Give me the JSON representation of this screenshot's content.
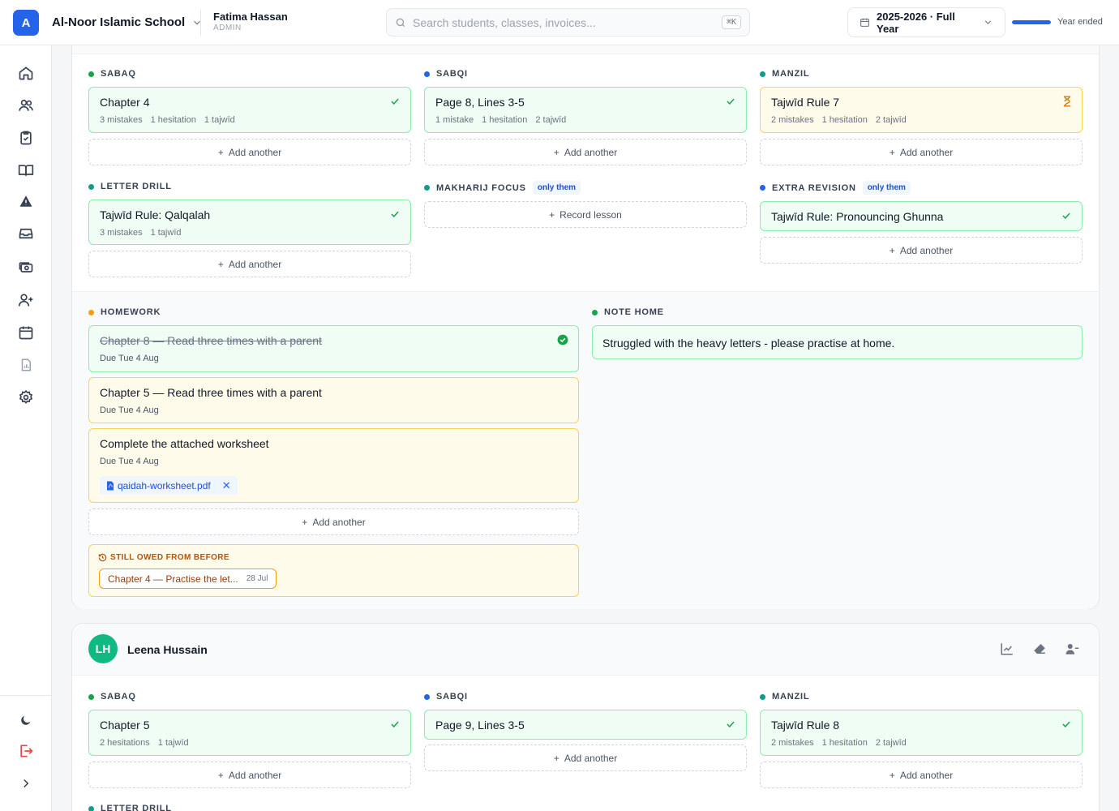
{
  "header": {
    "logo_letter": "A",
    "school_name": "Al-Noor Islamic School",
    "user_name": "Fatima Hassan",
    "user_role": "ADMIN",
    "search_placeholder": "Search students, classes, invoices...",
    "search_shortcut": "⌘K",
    "year_label": "2025-2026 · Full Year",
    "year_progress_percent": 100,
    "year_status": "Year ended"
  },
  "sidebar": {
    "items": [
      "home-icon",
      "users-icon",
      "clipboard-check-icon",
      "book-icon",
      "alert-icon",
      "inbox-icon",
      "money-icon",
      "user-plus-icon",
      "calendar-icon",
      "report-icon",
      "gear-icon"
    ],
    "footer": [
      "moon-icon",
      "logout-icon",
      "chevron-right-icon"
    ]
  },
  "student1": {
    "sabaq": {
      "label": "SABAQ",
      "title": "Chapter 4",
      "meta": [
        "3 mistakes",
        "1 hesitation",
        "1 tajwīd"
      ],
      "add": "Add another"
    },
    "sabqi": {
      "label": "SABQI",
      "title": "Page 8, Lines 3-5",
      "meta": [
        "1 mistake",
        "1 hesitation",
        "2 tajwīd"
      ],
      "add": "Add another"
    },
    "manzil": {
      "label": "MANZIL",
      "title": "Tajwīd Rule 7",
      "meta": [
        "2 mistakes",
        "1 hesitation",
        "2 tajwīd"
      ],
      "add": "Add another"
    },
    "letter_drill": {
      "label": "LETTER DRILL",
      "title": "Tajwīd Rule: Qalqalah",
      "meta": [
        "3 mistakes",
        "1 tajwīd"
      ],
      "add": "Add another"
    },
    "makharij": {
      "label": "MAKHARIJ FOCUS",
      "tag": "only them",
      "record": "Record lesson"
    },
    "extra": {
      "label": "EXTRA REVISION",
      "tag": "only them",
      "title": "Tajwīd Rule: Pronouncing Ghunna",
      "add": "Add another"
    },
    "homework": {
      "label": "HOMEWORK",
      "items": [
        {
          "title": "Chapter 8 — Read three times with a parent",
          "due": "Due Tue 4 Aug"
        },
        {
          "title": "Chapter 5 — Read three times with a parent",
          "due": "Due Tue 4 Aug"
        },
        {
          "title": "Complete the attached worksheet",
          "due": "Due Tue 4 Aug",
          "file": "qaidah-worksheet.pdf"
        }
      ],
      "add": "Add another",
      "owed_label": "STILL OWED FROM BEFORE",
      "owed_item": "Chapter 4 — Practise the let...",
      "owed_date": "28 Jul"
    },
    "note": {
      "label": "NOTE HOME",
      "text": "Struggled with the heavy letters - please practise at home."
    }
  },
  "student2": {
    "initials": "LH",
    "name": "Leena Hussain",
    "sabaq": {
      "label": "SABAQ",
      "title": "Chapter 5",
      "meta": [
        "2 hesitations",
        "1 tajwīd"
      ],
      "add": "Add another"
    },
    "sabqi": {
      "label": "SABQI",
      "title": "Page 9, Lines 3-5",
      "add": "Add another"
    },
    "manzil": {
      "label": "MANZIL",
      "title": "Tajwīd Rule 8",
      "meta": [
        "2 mistakes",
        "1 hesitation",
        "2 tajwīd"
      ],
      "add": "Add another"
    },
    "letter_drill_label": "LETTER DRILL"
  }
}
